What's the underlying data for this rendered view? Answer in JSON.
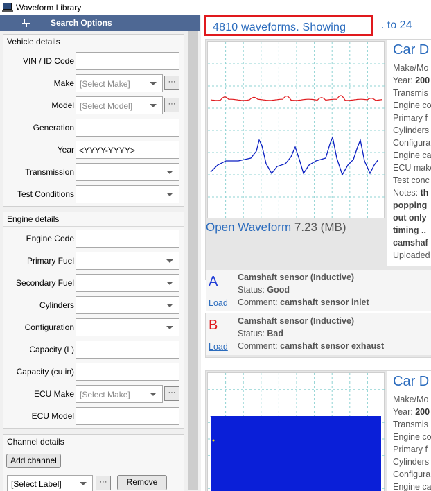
{
  "window": {
    "title": "Waveform Library"
  },
  "search_panel": {
    "title": "Search Options",
    "vehicle_details": {
      "title": "Vehicle details",
      "rows": [
        {
          "label": "VIN / ID Code",
          "type": "input",
          "value": ""
        },
        {
          "label": "Make",
          "type": "select-ellipsis",
          "value": "[Select Make]"
        },
        {
          "label": "Model",
          "type": "select-ellipsis",
          "value": "[Select Model]"
        },
        {
          "label": "Generation",
          "type": "input",
          "value": ""
        },
        {
          "label": "Year",
          "type": "input",
          "value": "<YYYY-YYYY>"
        },
        {
          "label": "Transmission",
          "type": "select",
          "value": ""
        },
        {
          "label": "Test Conditions",
          "type": "select",
          "value": ""
        }
      ]
    },
    "engine_details": {
      "title": "Engine details",
      "rows": [
        {
          "label": "Engine Code",
          "type": "input",
          "value": ""
        },
        {
          "label": "Primary Fuel",
          "type": "select",
          "value": ""
        },
        {
          "label": "Secondary Fuel",
          "type": "select",
          "value": ""
        },
        {
          "label": "Cylinders",
          "type": "select",
          "value": ""
        },
        {
          "label": "Configuration",
          "type": "select",
          "value": ""
        },
        {
          "label": "Capacity (L)",
          "type": "input",
          "value": ""
        },
        {
          "label": "Capacity (cu in)",
          "type": "input",
          "value": ""
        },
        {
          "label": "ECU Make",
          "type": "select-ellipsis",
          "value": "[Select Make]"
        },
        {
          "label": "ECU Model",
          "type": "input",
          "value": ""
        }
      ]
    },
    "channel_details": {
      "title": "Channel details",
      "add_channel": "Add channel",
      "label_select": "[Select Label]",
      "ellipsis": "···",
      "remove": "Remove"
    },
    "ellipsis": "···"
  },
  "results": {
    "count_text": "4810 waveforms. Showing",
    "range_text": ". to 24",
    "cards": [
      {
        "title": "Car D",
        "lines": [
          {
            "label": "Make/Mo",
            "value": ""
          },
          {
            "label": "Year: ",
            "value": "200"
          },
          {
            "label": "Transmis",
            "value": ""
          },
          {
            "label": "Engine co",
            "value": ""
          },
          {
            "label": "Primary f",
            "value": ""
          },
          {
            "label": "Cylinders",
            "value": ""
          },
          {
            "label": "Configura",
            "value": ""
          },
          {
            "label": "Engine ca",
            "value": ""
          },
          {
            "label": "ECU make",
            "value": ""
          },
          {
            "label": "Test conc",
            "value": ""
          },
          {
            "label": "Notes: ",
            "value": "th"
          }
        ],
        "notes": [
          "popping",
          "out only",
          "timing ..",
          "camshaf"
        ],
        "uploaded": "Uploaded",
        "open_link": "Open Waveform",
        "size": "7.23 (MB)",
        "channels": [
          {
            "letter": "A",
            "color": "#1f3cd6",
            "load": "Load",
            "name": "Camshaft sensor (Inductive)",
            "status_label": "Status: ",
            "status": "Good",
            "comment_label": "Comment: ",
            "comment": "camshaft sensor inlet"
          },
          {
            "letter": "B",
            "color": "#e0191d",
            "load": "Load",
            "name": "Camshaft sensor (Inductive)",
            "status_label": "Status: ",
            "status": "Bad",
            "comment_label": "Comment: ",
            "comment": "camshaft sensor exhaust"
          }
        ]
      },
      {
        "title": "Car D",
        "lines": [
          {
            "label": "Make/Mo",
            "value": ""
          },
          {
            "label": "Year: ",
            "value": "200"
          },
          {
            "label": "Transmis",
            "value": ""
          },
          {
            "label": "Engine co",
            "value": ""
          },
          {
            "label": "Primary f",
            "value": ""
          },
          {
            "label": "Cylinders",
            "value": ""
          },
          {
            "label": "Configura",
            "value": ""
          },
          {
            "label": "Engine ca",
            "value": ""
          }
        ]
      }
    ]
  },
  "colors": {
    "header_bg": "#4e6894",
    "link": "#2a6bbd",
    "highlight_border": "#e0191d",
    "trace_a": "#0a1fc2",
    "trace_b": "#e0191d",
    "grid": "#8fd3d3"
  }
}
